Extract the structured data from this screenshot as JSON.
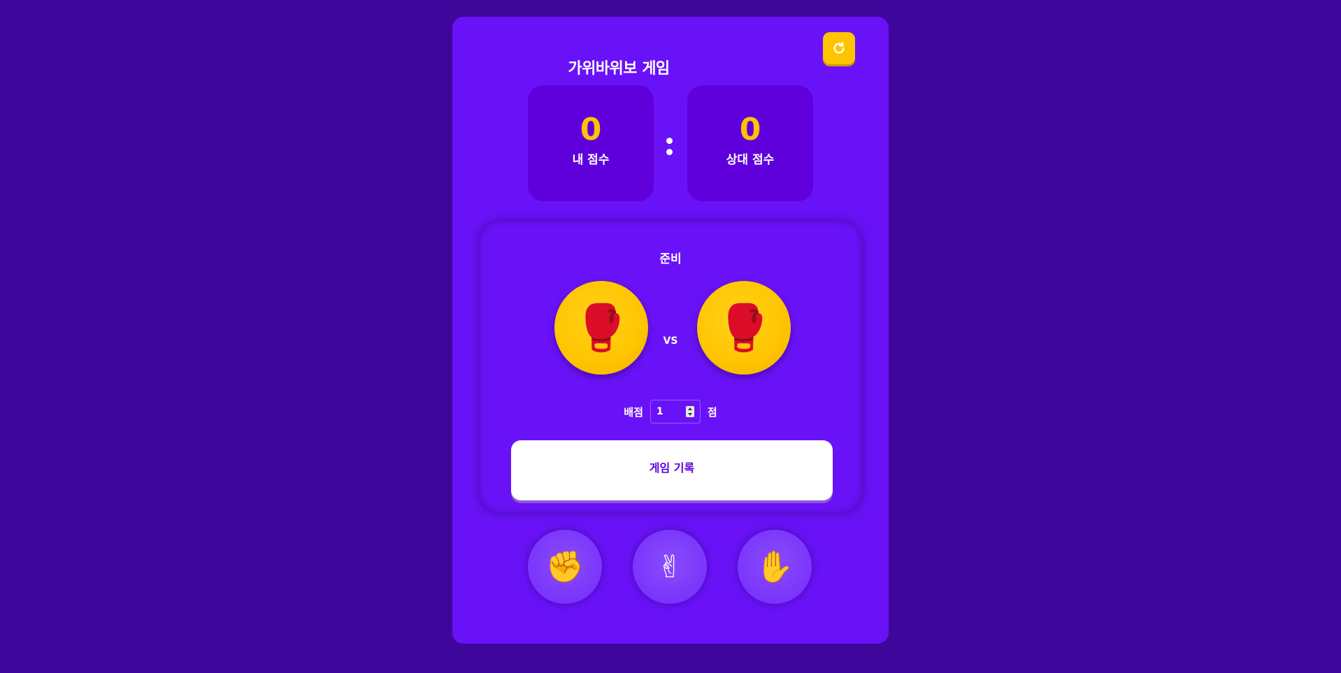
{
  "header": {
    "title": "가위바위보 게임",
    "refresh_icon": "refresh-icon"
  },
  "scores": {
    "mine": {
      "value": "0",
      "label": "내 점수"
    },
    "opponent": {
      "value": "0",
      "label": "상대 점수"
    }
  },
  "arena": {
    "status": "준비",
    "player_hand_icon": "boxing-glove-icon",
    "opponent_hand_icon": "boxing-glove-icon",
    "vs_label": "VS",
    "bet": {
      "label": "배점",
      "value": "1",
      "unit": "점"
    },
    "history_title": "게임 기록"
  },
  "choices": [
    {
      "name": "rock",
      "icon": "fist-icon"
    },
    {
      "name": "scissors",
      "icon": "victory-hand-icon"
    },
    {
      "name": "paper",
      "icon": "open-hand-icon"
    }
  ],
  "colors": {
    "background": "#3f069b",
    "card": "#6a12f7",
    "accent_yellow": "#ffc400",
    "score_box": "#5f00dc"
  }
}
